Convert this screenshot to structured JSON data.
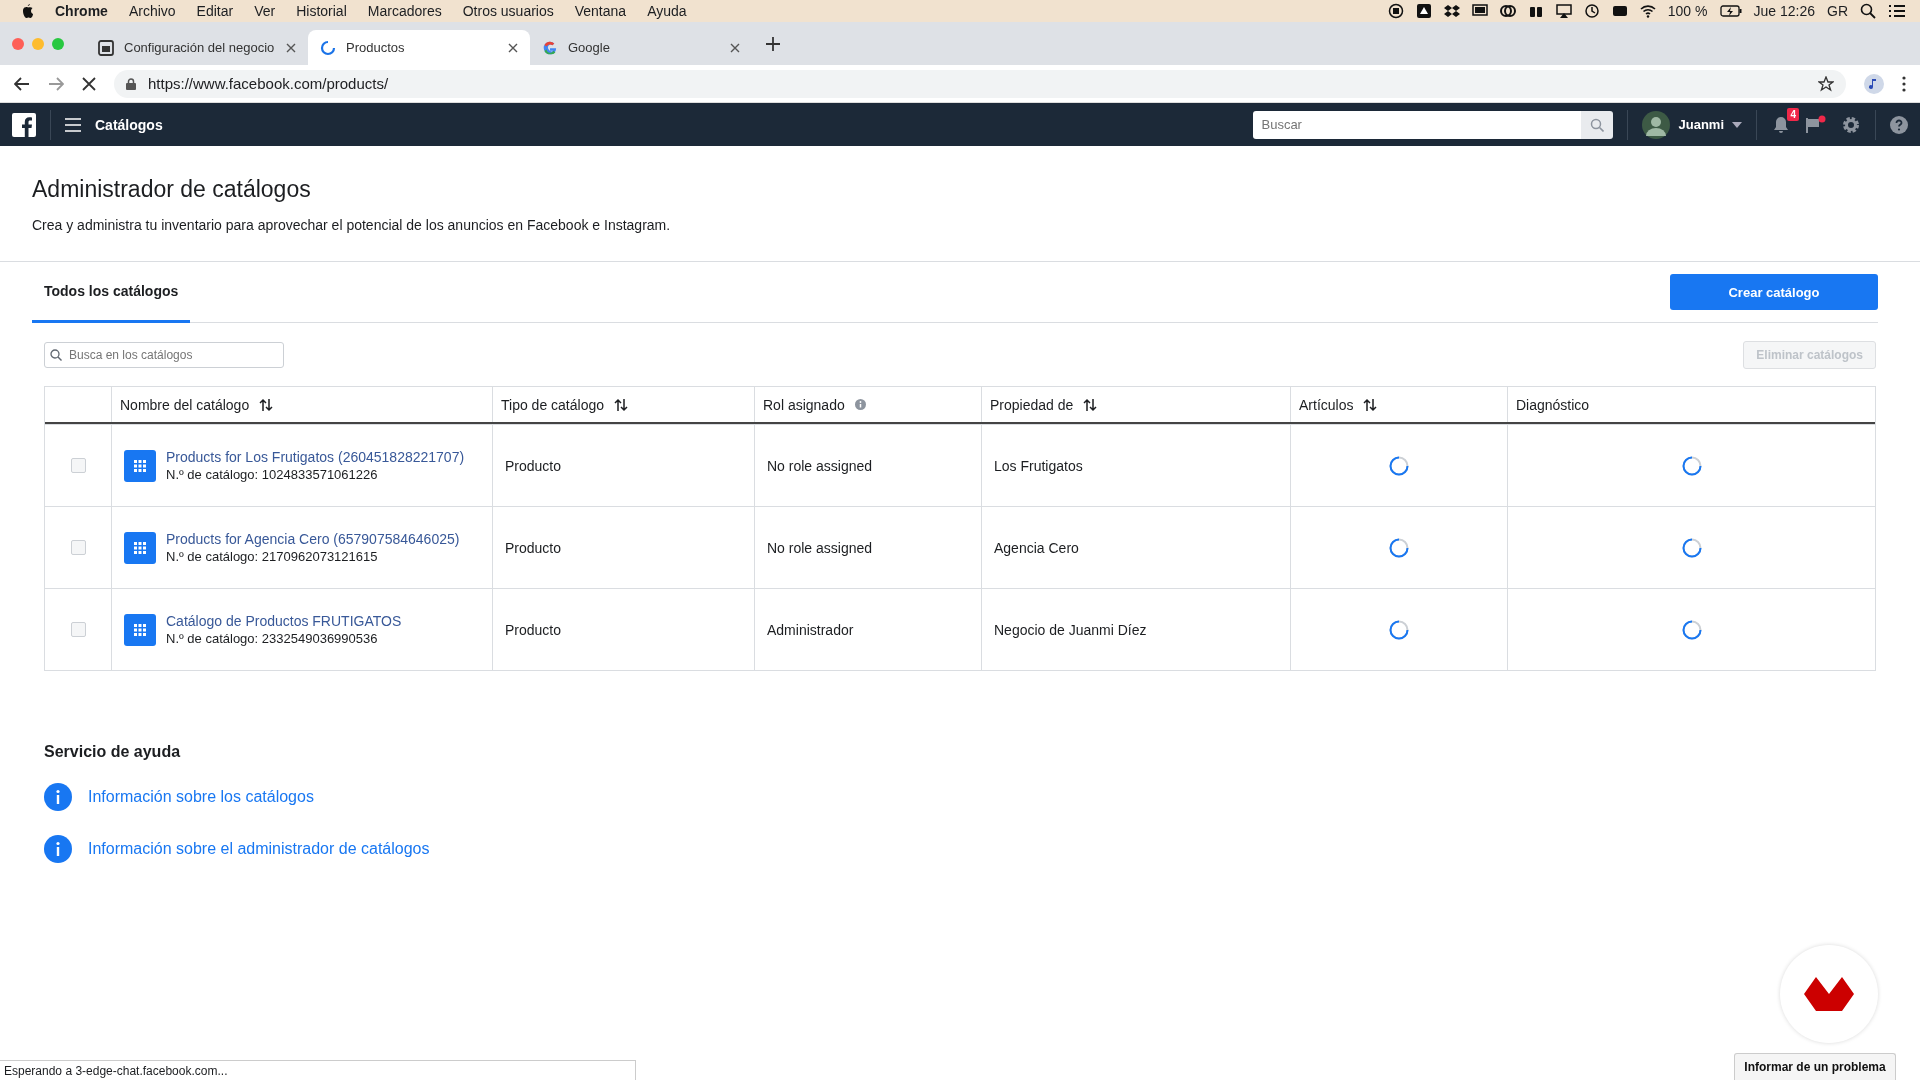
{
  "menu_bar": {
    "app": "Chrome",
    "items": [
      "Archivo",
      "Editar",
      "Ver",
      "Historial",
      "Marcadores",
      "Otros usuarios",
      "Ventana",
      "Ayuda"
    ],
    "battery": "100 %",
    "clock": "Jue 12:26",
    "user": "GR"
  },
  "browser_tabs": [
    {
      "title": "Configuración del negocio",
      "kind": "page",
      "selected": false
    },
    {
      "title": "Productos",
      "kind": "loading",
      "selected": true
    },
    {
      "title": "Google",
      "kind": "google",
      "selected": false
    }
  ],
  "address_bar": {
    "url": "https://www.facebook.com/products/"
  },
  "top_nav": {
    "title": "Catálogos",
    "search_placeholder": "Buscar",
    "user": "Juanmi",
    "notifications": "4"
  },
  "page": {
    "title": "Administrador de catálogos",
    "subtitle": "Crea y administra tu inventario para aprovechar el potencial de los anuncios en Facebook e Instagram."
  },
  "tabs": [
    {
      "label": "Todos los catálogos",
      "selected": true
    }
  ],
  "create_button": "Crear catálogo",
  "search": {
    "placeholder": "Busca en los catálogos"
  },
  "delete_button": {
    "label": "Eliminar catálogos",
    "disabled": true
  },
  "table": {
    "columns": [
      {
        "label": "Nombre del catálogo",
        "kind": "sortable"
      },
      {
        "label": "Tipo de catálogo",
        "kind": "sortable"
      },
      {
        "label": "Rol asignado",
        "kind": "info"
      },
      {
        "label": "Propiedad de",
        "kind": "sortable"
      },
      {
        "label": "Artículos",
        "kind": "sortable"
      },
      {
        "label": "Diagnóstico",
        "kind": "plain"
      }
    ],
    "rows": [
      {
        "checked": false,
        "name": "Products for Los Frutigatos (260451828221707)",
        "number": "N.º de catálogo: 1024833571061226",
        "type": "Producto",
        "role": "No role assigned",
        "owner": "Los Frutigatos"
      },
      {
        "checked": false,
        "name": "Products for Agencia Cero (657907584646025)",
        "number": "N.º de catálogo: 2170962073121615",
        "type": "Producto",
        "role": "No role assigned",
        "owner": "Agencia Cero"
      },
      {
        "checked": false,
        "name": "Catálogo de Productos FRUTIGATOS",
        "number": "N.º de catálogo: 2332549036990536",
        "type": "Producto",
        "role": "Administrador",
        "owner": "Negocio de Juanmi Díez"
      }
    ]
  },
  "help": {
    "title": "Servicio de ayuda",
    "links": [
      "Información sobre los catálogos",
      "Información sobre el administrador de catálogos"
    ]
  },
  "status_bar": "Esperando a 3-edge-chat.facebook.com...",
  "report_button": "Informar de un problema"
}
